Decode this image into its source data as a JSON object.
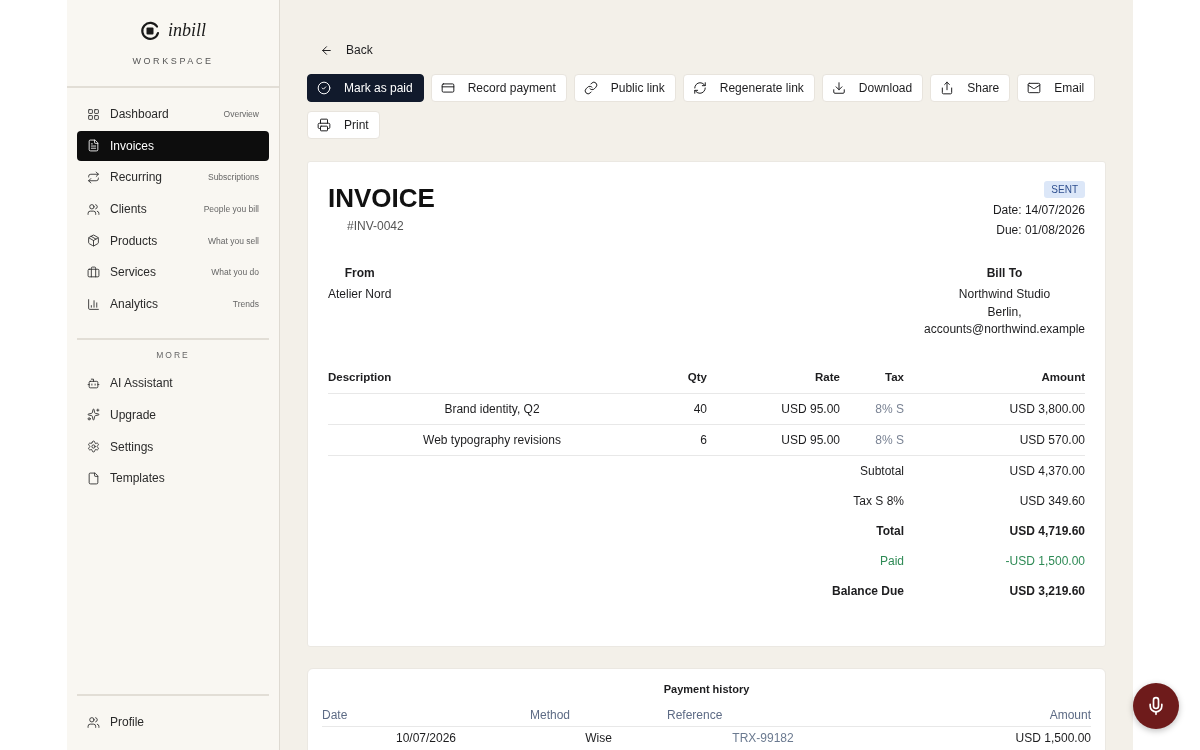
{
  "sidebar": {
    "brand": "inbill",
    "workspace": "WORKSPACE",
    "nav": [
      {
        "label": "Dashboard",
        "hint": "Overview",
        "selected": false
      },
      {
        "label": "Invoices",
        "selected": true
      },
      {
        "label": "Recurring",
        "hint": "Subscriptions",
        "selected": false
      },
      {
        "label": "Clients",
        "hint": "People you bill",
        "selected": false
      },
      {
        "label": "Products",
        "hint": "What you sell",
        "selected": false
      },
      {
        "label": "Services",
        "hint": "What you do",
        "selected": false
      },
      {
        "label": "Analytics",
        "hint": "Trends",
        "selected": false
      }
    ],
    "more_heading": "MORE",
    "more": [
      {
        "label": "AI Assistant",
        "selected": false
      },
      {
        "label": "Upgrade",
        "selected": false
      },
      {
        "label": "Settings",
        "selected": false
      },
      {
        "label": "Templates",
        "selected": false
      }
    ],
    "footer": [
      {
        "label": "Profile",
        "selected": false
      }
    ]
  },
  "back": "Back",
  "actions": [
    {
      "label": "Mark as paid",
      "kind": "primary"
    },
    {
      "label": "Record payment",
      "kind": "secondary"
    },
    {
      "label": "Public link",
      "kind": "secondary"
    },
    {
      "label": "Regenerate link",
      "kind": "secondary"
    },
    {
      "label": "Download",
      "kind": "secondary"
    },
    {
      "label": "Share",
      "kind": "secondary"
    },
    {
      "label": "Email",
      "kind": "secondary"
    },
    {
      "label": "Print",
      "kind": "secondary"
    }
  ],
  "invoice": {
    "title": "INVOICE",
    "number": "#INV-0042",
    "status": "SENT",
    "date": "Date: 14/07/2026",
    "due": "Due: 01/08/2026",
    "from": {
      "heading": "From",
      "lines": [
        "Atelier Nord"
      ]
    },
    "bill_to": {
      "heading": "Bill To",
      "lines": [
        "Northwind Studio",
        "Berlin,",
        "accounts@northwind.example"
      ]
    },
    "columns": [
      "Description",
      "Qty",
      "Rate",
      "Tax",
      "Amount"
    ],
    "items": [
      {
        "description": "Brand identity, Q2",
        "qty": "40",
        "rate": "USD 95.00",
        "tax": "8% S",
        "amount": "USD 3,800.00"
      },
      {
        "description": "Web typography revisions",
        "qty": "6",
        "rate": "USD 95.00",
        "tax": "8% S",
        "amount": "USD 570.00"
      }
    ],
    "summary": [
      {
        "label": "Subtotal",
        "value": "USD 4,370.00",
        "kind": "plain"
      },
      {
        "label": "Tax S 8%",
        "value": "USD 349.60",
        "kind": "plain"
      },
      {
        "label": "Total",
        "value": "USD 4,719.60",
        "kind": "total"
      },
      {
        "label": "Paid",
        "value": "-USD 1,500.00",
        "kind": "paid"
      },
      {
        "label": "Balance Due",
        "value": "USD 3,219.60",
        "kind": "total"
      }
    ]
  },
  "payment_history": {
    "title": "Payment history",
    "columns": [
      "Date",
      "Method",
      "Reference",
      "Amount"
    ],
    "rows": [
      {
        "date": "10/07/2026",
        "method": "Wise",
        "reference": "TRX-99182",
        "amount": "USD 1,500.00"
      }
    ]
  }
}
